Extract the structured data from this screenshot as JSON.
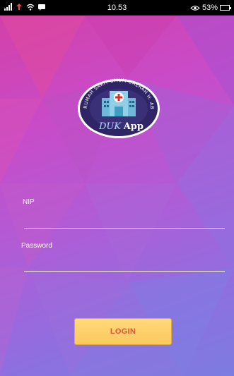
{
  "status_bar": {
    "time": "10.53",
    "battery": "53%",
    "battery_level": 0.53,
    "icons": [
      "signal-icon",
      "data-transfer-icon",
      "wifi-icon",
      "message-icon",
      "eye-icon",
      "battery-icon"
    ]
  },
  "logo": {
    "ring_text": "RUMAH SAKIT UMUM DAERAH H. ABDUL MANAP KOTA JAMBI",
    "app_name_part1": "DUK",
    "app_name_part2": "App",
    "ring_color": "#2e2466",
    "cross_color": "#e02a2a"
  },
  "form": {
    "nip_label": "NIP",
    "nip_value": "",
    "password_label": "Password",
    "password_value": ""
  },
  "login_button": {
    "label": "LOGIN",
    "bg_color": "#fbd36c",
    "text_color": "#e0553a"
  },
  "colors": {
    "bg_top": "#d43fa4",
    "bg_bottom": "#7c7ce0"
  }
}
